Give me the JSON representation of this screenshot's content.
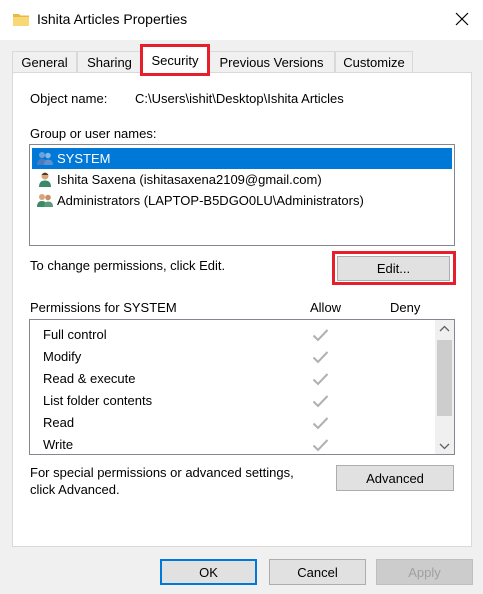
{
  "window": {
    "title": "Ishita Articles Properties"
  },
  "tabs": [
    {
      "label": "General"
    },
    {
      "label": "Sharing"
    },
    {
      "label": "Security"
    },
    {
      "label": "Previous Versions"
    },
    {
      "label": "Customize"
    }
  ],
  "security": {
    "object_name_label": "Object name:",
    "object_name_value": "C:\\Users\\ishit\\Desktop\\Ishita Articles",
    "group_label": "Group or user names:",
    "users": [
      {
        "name": "SYSTEM",
        "icon": "users-group-icon"
      },
      {
        "name": "Ishita Saxena (ishitasaxena2109@gmail.com)",
        "icon": "user-icon"
      },
      {
        "name": "Administrators (LAPTOP-B5DGO0LU\\Administrators)",
        "icon": "users-group-icon"
      }
    ],
    "change_permissions_text": "To change permissions, click Edit.",
    "edit_label": "Edit...",
    "permissions_for_label": "Permissions for SYSTEM",
    "allow_header": "Allow",
    "deny_header": "Deny",
    "permissions": [
      {
        "name": "Full control",
        "allow": true,
        "deny": false
      },
      {
        "name": "Modify",
        "allow": true,
        "deny": false
      },
      {
        "name": "Read & execute",
        "allow": true,
        "deny": false
      },
      {
        "name": "List folder contents",
        "allow": true,
        "deny": false
      },
      {
        "name": "Read",
        "allow": true,
        "deny": false
      },
      {
        "name": "Write",
        "allow": true,
        "deny": false
      }
    ],
    "advanced_text_line1": "For special permissions or advanced settings,",
    "advanced_text_line2": "click Advanced.",
    "advanced_label": "Advanced"
  },
  "footer": {
    "ok_label": "OK",
    "cancel_label": "Cancel",
    "apply_label": "Apply"
  },
  "colors": {
    "selection": "#0078d7",
    "highlight_box": "#e5202a",
    "check_gray": "#b0b0b0"
  }
}
